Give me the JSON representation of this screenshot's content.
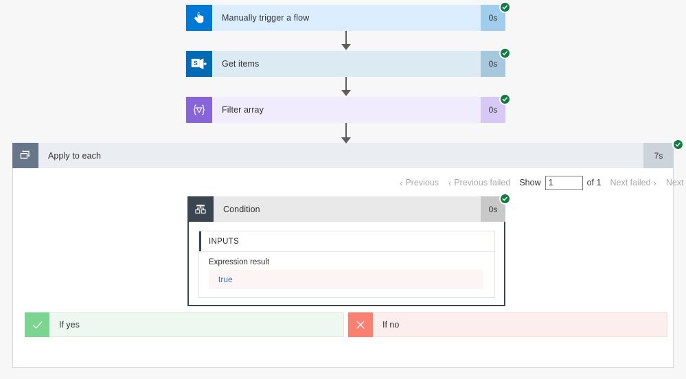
{
  "flow": {
    "nodes": [
      {
        "id": "manually-trigger-a-flow",
        "label": "Manually trigger a flow",
        "duration": "0s",
        "status": "succeeded",
        "icon": "tap-hand-icon",
        "icon_color": "#0078d7"
      },
      {
        "id": "get-items",
        "label": "Get items",
        "duration": "0s",
        "status": "succeeded",
        "icon": "sharepoint-icon",
        "icon_color": "#036ab5"
      },
      {
        "id": "filter-array",
        "label": "Filter array",
        "duration": "0s",
        "status": "succeeded",
        "icon": "filter-array-icon",
        "icon_color": "#8764d8"
      },
      {
        "id": "apply-to-each",
        "label": "Apply to each",
        "duration": "7s",
        "status": "succeeded",
        "icon": "loop-icon",
        "icon_color": "#68768a"
      },
      {
        "id": "condition",
        "label": "Condition",
        "duration": "0s",
        "status": "succeeded",
        "icon": "condition-branch-icon",
        "icon_color": "#3b4552"
      }
    ]
  },
  "pager": {
    "previous_label": "Previous",
    "previous_failed_label": "Previous failed",
    "show_label": "Show",
    "show_value": "1",
    "show_placeholder": "1",
    "of_label": "of 1",
    "next_failed_label": "Next failed",
    "next_label": "Next",
    "chevron_left": "‹",
    "chevron_right": "›"
  },
  "condition_details": {
    "section_title": "INPUTS",
    "field_label": "Expression result",
    "field_value": "true"
  },
  "branches": {
    "yes": {
      "label": "If yes",
      "icon": "check-icon"
    },
    "no": {
      "label": "If no",
      "icon": "close-x-icon"
    }
  },
  "colors": {
    "success": "#107c41",
    "page_background": "#f7f7f7",
    "yes_accent": "#7bd490",
    "no_accent": "#fa8072",
    "value_text": "#3b6fb6"
  }
}
